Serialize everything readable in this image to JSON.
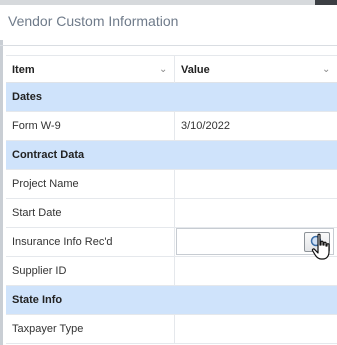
{
  "window": {
    "title": "Vendor Custom Information"
  },
  "grid": {
    "columns": [
      {
        "label": "Item",
        "menu_icon": "chevron-down-icon"
      },
      {
        "label": "Value",
        "menu_icon": "chevron-down-icon"
      }
    ],
    "rows": [
      {
        "type": "group",
        "item": "Dates",
        "value": ""
      },
      {
        "type": "data",
        "item": "Form W-9",
        "value": "3/10/2022"
      },
      {
        "type": "group",
        "item": "Contract Data",
        "value": ""
      },
      {
        "type": "data",
        "item": "Project Name",
        "value": ""
      },
      {
        "type": "data",
        "item": "Start Date",
        "value": ""
      },
      {
        "type": "data",
        "item": "Insurance Info Rec'd",
        "value": "",
        "editing": true,
        "lookup_icon": "search-lookup-icon"
      },
      {
        "type": "data",
        "item": "Supplier ID",
        "value": ""
      },
      {
        "type": "group",
        "item": "State Info",
        "value": ""
      },
      {
        "type": "data",
        "item": "Taxpayer Type",
        "value": ""
      }
    ]
  },
  "colors": {
    "group_row_bg": "#cfe3fb",
    "title_text": "#6f7b8a",
    "grid_line": "#e5e8ec"
  },
  "cursor": {
    "icon": "hand-pointer-icon"
  }
}
